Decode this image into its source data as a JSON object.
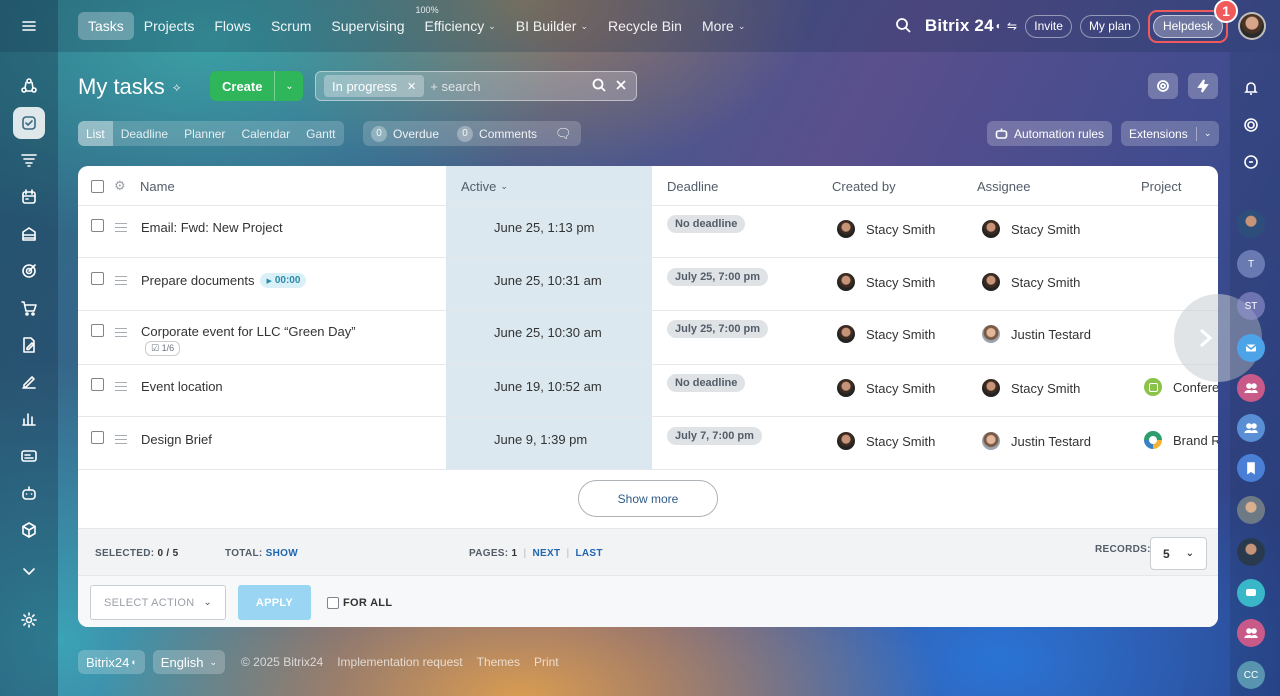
{
  "top_nav": {
    "items": [
      {
        "label": "Tasks",
        "active": true,
        "dropdown": false
      },
      {
        "label": "Projects",
        "active": false,
        "dropdown": false
      },
      {
        "label": "Flows",
        "active": false,
        "dropdown": false
      },
      {
        "label": "Scrum",
        "active": false,
        "dropdown": false
      },
      {
        "label": "Supervising",
        "active": false,
        "dropdown": false
      },
      {
        "label": "Efficiency",
        "active": false,
        "dropdown": true,
        "badge": "100%"
      },
      {
        "label": "BI Builder",
        "active": false,
        "dropdown": true
      },
      {
        "label": "Recycle Bin",
        "active": false,
        "dropdown": false
      },
      {
        "label": "More",
        "active": false,
        "dropdown": true
      }
    ],
    "brand": "Bitrix 24",
    "invite_label": "Invite",
    "my_plan_label": "My plan",
    "helpdesk_label": "Helpdesk",
    "step_number": "1"
  },
  "header": {
    "title": "My tasks",
    "create_label": "Create",
    "filter_chip": "In progress",
    "search_placeholder": "+ search"
  },
  "view_tabs": [
    "List",
    "Deadline",
    "Planner",
    "Calendar",
    "Gantt"
  ],
  "counters": {
    "overdue_count": "0",
    "overdue_label": "Overdue",
    "comments_count": "0",
    "comments_label": "Comments"
  },
  "toolbar": {
    "automation_label": "Automation rules",
    "extensions_label": "Extensions"
  },
  "grid": {
    "columns": {
      "name": "Name",
      "active": "Active",
      "deadline": "Deadline",
      "created_by": "Created by",
      "assignee": "Assignee",
      "project": "Project"
    },
    "rows": [
      {
        "name": "Email: Fwd: New Project",
        "active": "June 25, 1:13 pm",
        "deadline": "No deadline",
        "created_by": "Stacy Smith",
        "assignee": "Stacy Smith",
        "project": "",
        "timer": "",
        "checklist": ""
      },
      {
        "name": "Prepare documents",
        "active": "June 25, 10:31 am",
        "deadline": "July 25, 7:00 pm",
        "created_by": "Stacy Smith",
        "assignee": "Stacy Smith",
        "project": "",
        "timer": "00:00",
        "checklist": ""
      },
      {
        "name": "Corporate event for LLC “Green Day”",
        "active": "June 25, 10:30 am",
        "deadline": "July 25, 7:00 pm",
        "created_by": "Stacy Smith",
        "assignee": "Justin Testard",
        "project": "",
        "timer": "",
        "checklist": "1/6"
      },
      {
        "name": "Event location",
        "active": "June 19, 10:52 am",
        "deadline": "No deadline",
        "created_by": "Stacy Smith",
        "assignee": "Stacy Smith",
        "project": "Confere",
        "timer": "",
        "checklist": ""
      },
      {
        "name": "Design Brief",
        "active": "June 9, 1:39 pm",
        "deadline": "July 7, 7:00 pm",
        "created_by": "Stacy Smith",
        "assignee": "Justin Testard",
        "project": "Brand R",
        "timer": "",
        "checklist": ""
      }
    ],
    "show_more_label": "Show more"
  },
  "footer_bar": {
    "selected_label": "SELECTED:",
    "selected_value": "0 / 5",
    "total_label": "TOTAL:",
    "total_link": "SHOW",
    "pages_label": "PAGES:",
    "pages_value": "1",
    "next_label": "NEXT",
    "last_label": "LAST",
    "records_label": "RECORDS:",
    "records_value": "5"
  },
  "action_bar": {
    "select_action_label": "SELECT ACTION",
    "apply_label": "APPLY",
    "for_all_label": "FOR ALL"
  },
  "right_bar": {
    "letters": [
      "T",
      "ST",
      "CC"
    ]
  },
  "page_footer": {
    "brand": "Bitrix24",
    "language": "English",
    "copyright": "© 2025 Bitrix24",
    "links": [
      "Implementation request",
      "Themes",
      "Print"
    ]
  },
  "colors": {
    "create_green": "#2fb55a",
    "highlight_red": "#f05a5a",
    "link_blue": "#2066b0",
    "apply_blue": "#9ad6f4"
  }
}
